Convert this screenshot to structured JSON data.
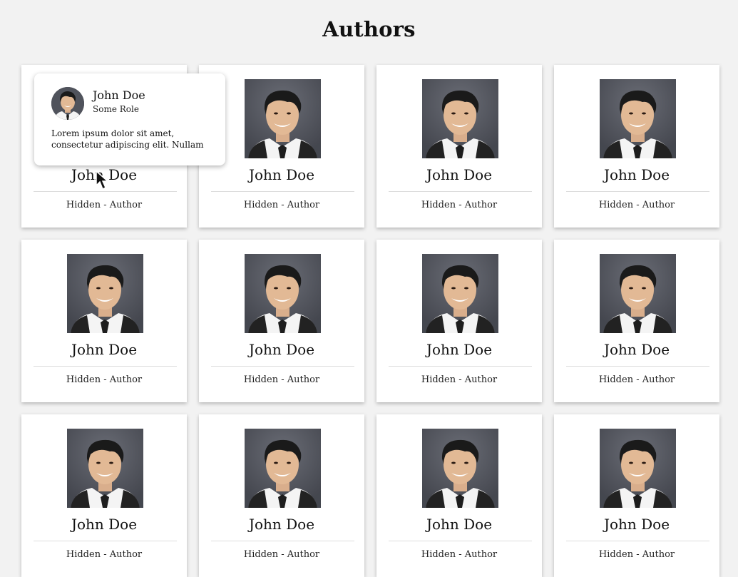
{
  "page": {
    "title": "Authors"
  },
  "authors": [
    {
      "name": "John Doe",
      "role": "Hidden - Author"
    },
    {
      "name": "John Doe",
      "role": "Hidden - Author"
    },
    {
      "name": "John Doe",
      "role": "Hidden - Author"
    },
    {
      "name": "John Doe",
      "role": "Hidden - Author"
    },
    {
      "name": "John Doe",
      "role": "Hidden - Author"
    },
    {
      "name": "John Doe",
      "role": "Hidden - Author"
    },
    {
      "name": "John Doe",
      "role": "Hidden - Author"
    },
    {
      "name": "John Doe",
      "role": "Hidden - Author"
    },
    {
      "name": "John Doe",
      "role": "Hidden - Author"
    },
    {
      "name": "John Doe",
      "role": "Hidden - Author"
    },
    {
      "name": "John Doe",
      "role": "Hidden - Author"
    },
    {
      "name": "John Doe",
      "role": "Hidden - Author"
    }
  ],
  "tooltip": {
    "name": "John Doe",
    "role": "Some Role",
    "bio": "Lorem ipsum dolor sit amet, consectetur adipiscing elit. Nullam"
  },
  "icons": {
    "cursor": "mouse-pointer-icon",
    "photo": "author-photo"
  },
  "colors": {
    "background": "#f2f2f2",
    "card": "#ffffff",
    "photo_bg": "#4f5159"
  }
}
